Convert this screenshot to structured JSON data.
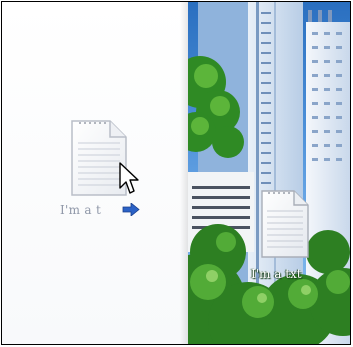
{
  "left_file": {
    "icon": "text-document-icon",
    "label": "I'm a t"
  },
  "right_file": {
    "icon": "text-document-icon",
    "label": "I'm a txt"
  },
  "cursor": {
    "icon": "pointer-cursor-icon"
  },
  "colors": {
    "left_bg": "#ffffff",
    "wallpaper_sky": "#4b8ed7",
    "foliage": "#3a9a2e",
    "label_left": "#8f97a8",
    "arrow": "#2b62c6"
  }
}
